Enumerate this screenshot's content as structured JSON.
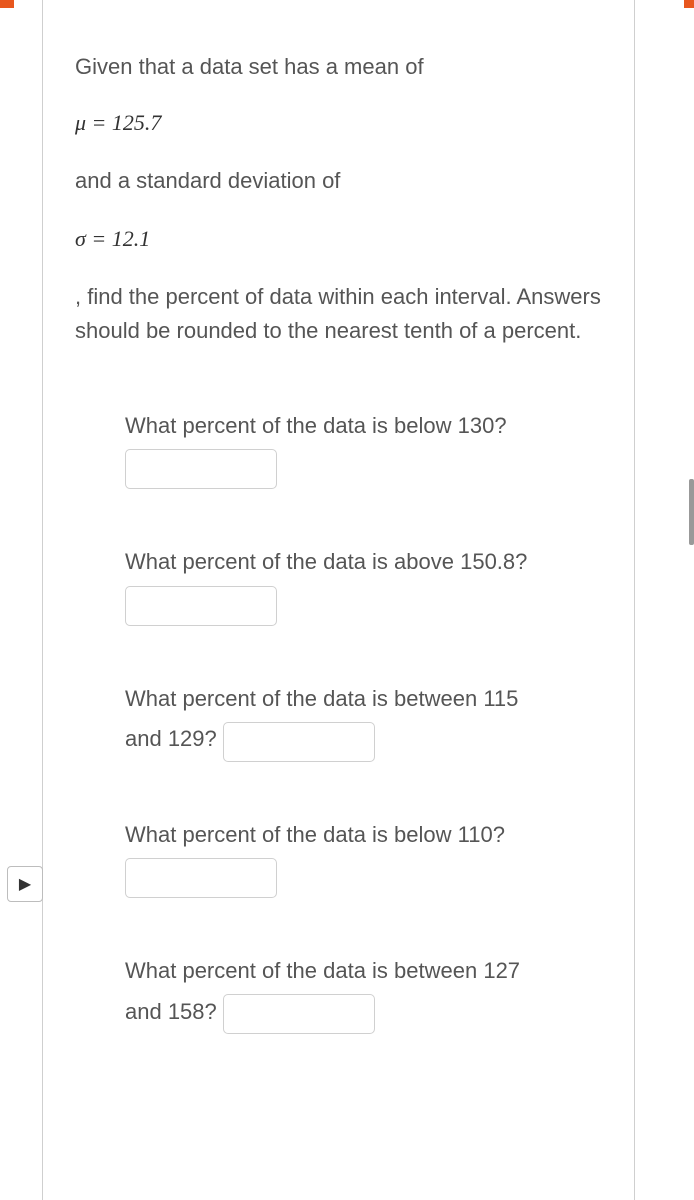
{
  "intro": {
    "line1": "Given that a data set has a mean of",
    "mu_expr": "μ = 125.7",
    "line2": "and a standard deviation of",
    "sigma_expr": "σ = 12.1",
    "instruction": ", find the percent of data within each interval. Answers should be rounded to the nearest tenth of a percent."
  },
  "questions": {
    "q1": {
      "text": "What percent of the data is below 130?",
      "value": ""
    },
    "q2": {
      "text": "What percent of the data is above 150.8?",
      "value": ""
    },
    "q3": {
      "text_a": "What percent of the data is between 115",
      "text_b": "and 129?",
      "value": ""
    },
    "q4": {
      "text": "What percent of the data is below 110?",
      "value": ""
    },
    "q5": {
      "text_a": "What percent of the data is between 127",
      "text_b": "and 158?",
      "value": ""
    }
  },
  "nav": {
    "play": "▶"
  }
}
